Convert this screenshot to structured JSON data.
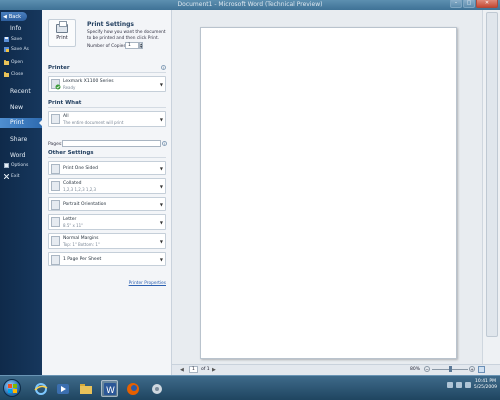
{
  "window": {
    "title": "Document1 - Microsoft Word (Technical Preview)",
    "controls": [
      "–",
      "□",
      "✕"
    ]
  },
  "backstage": {
    "back_label": "Back",
    "items": [
      {
        "label": "Info",
        "type": "main"
      },
      {
        "label": "Save",
        "type": "sub",
        "icon": "save-icon"
      },
      {
        "label": "Save As",
        "type": "sub",
        "icon": "save-as-icon"
      },
      {
        "label": "Open",
        "type": "sub",
        "icon": "folder-icon"
      },
      {
        "label": "Close",
        "type": "sub",
        "icon": "folder-icon"
      },
      {
        "label": "Recent",
        "type": "main"
      },
      {
        "label": "New",
        "type": "main"
      },
      {
        "label": "Print",
        "type": "main",
        "selected": true
      },
      {
        "label": "Share",
        "type": "main"
      },
      {
        "label": "Word",
        "type": "main"
      },
      {
        "label": "Options",
        "type": "sub",
        "icon": "options-icon"
      },
      {
        "label": "Exit",
        "type": "sub",
        "icon": "exit-icon"
      }
    ]
  },
  "print_settings": {
    "print_button_label": "Print",
    "title": "Print Settings",
    "description": "Specify how you want the document to be printed and then click Print.",
    "copies_label": "Number of Copies:",
    "copies_value": "1"
  },
  "printer": {
    "section_title": "Printer",
    "name": "Lexmark X1100 Series",
    "status": "Ready"
  },
  "print_what": {
    "section_title": "Print What",
    "value": "All",
    "sub": "The entire document will print",
    "pages_label": "Pages:"
  },
  "other_settings": {
    "section_title": "Other Settings",
    "sides": {
      "main": "Print One Sided"
    },
    "collation": {
      "main": "Collated",
      "sub": "1,2,3    1,2,3    1,2,3"
    },
    "orientation": {
      "main": "Portrait Orientation"
    },
    "paper": {
      "main": "Letter",
      "sub": "8.5\" x 11\""
    },
    "margins": {
      "main": "Normal Margins",
      "sub": "Top: 1\"    Bottom: 1\""
    },
    "per_sheet": {
      "main": "1 Page Per Sheet"
    },
    "printer_properties": "Printer Properties"
  },
  "preview_footer": {
    "page_value": "1",
    "page_of": "of 1",
    "zoom": "80%",
    "zoom_level": 0.5
  },
  "taskbar": {
    "clock_time": "10:41 PM",
    "clock_date": "5/25/2009"
  },
  "colors": {
    "accent": "#2e6bb0",
    "backstage_bg": "#16375d"
  }
}
